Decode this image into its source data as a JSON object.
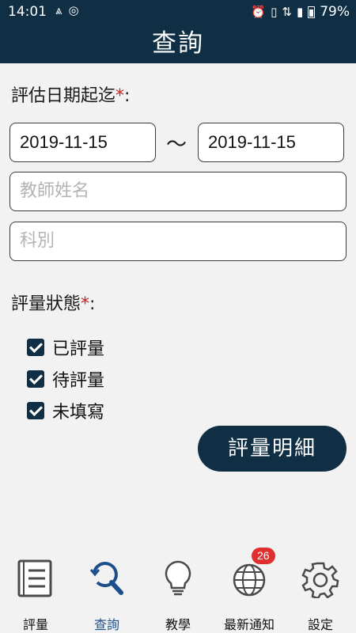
{
  "status_bar": {
    "time": "14:01",
    "battery": "79%"
  },
  "app_bar": {
    "title": "查詢"
  },
  "form": {
    "date_label": "評估日期起迄",
    "required_mark": "*",
    "label_colon": ":",
    "date_start": "2019-11-15",
    "date_separator": "～",
    "date_end": "2019-11-15",
    "teacher_placeholder": "教師姓名",
    "subject_placeholder": "科別",
    "status_label": "評量狀態",
    "status_options": [
      {
        "label": "已評量",
        "checked": true
      },
      {
        "label": "待評量",
        "checked": true
      },
      {
        "label": "未填寫",
        "checked": true
      }
    ],
    "detail_button": "評量明細"
  },
  "tabs": [
    {
      "label": "評量",
      "icon": "list-book-icon",
      "active": false
    },
    {
      "label": "查詢",
      "icon": "search-icon",
      "active": true
    },
    {
      "label": "教學",
      "icon": "lightbulb-icon",
      "active": false
    },
    {
      "label": "最新通知",
      "icon": "globe-icon",
      "active": false,
      "badge": "26"
    },
    {
      "label": "設定",
      "icon": "gear-icon",
      "active": false
    }
  ],
  "colors": {
    "primary": "#102f45",
    "accent_active": "#1d4f8a",
    "required": "#d21b1b",
    "badge": "#e02f2f"
  }
}
